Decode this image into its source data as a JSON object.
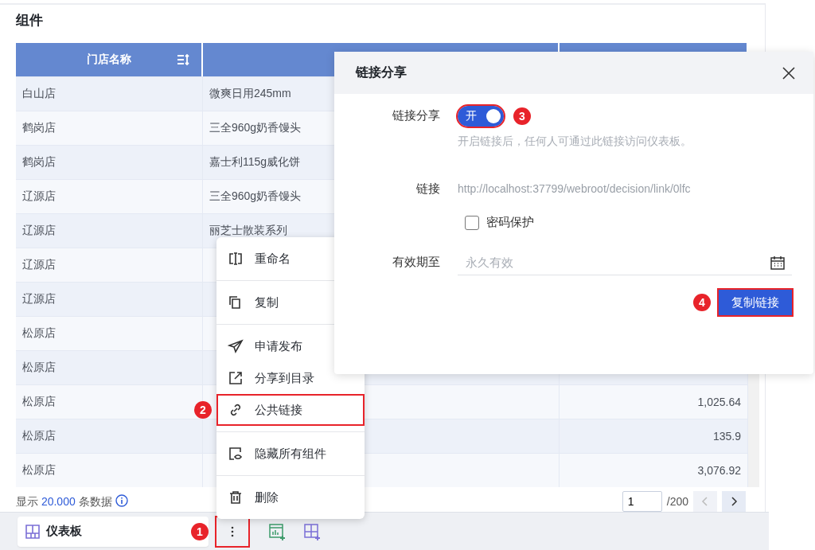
{
  "panel": {
    "title": "组件"
  },
  "table": {
    "header": {
      "column_1": "门店名称"
    },
    "rows": [
      {
        "store": "白山店",
        "product": "微爽日用245mm"
      },
      {
        "store": "鹤岗店",
        "product": "三全960g奶香馒头"
      },
      {
        "store": "鹤岗店",
        "product": "嘉士利115g威化饼"
      },
      {
        "store": "辽源店",
        "product": "三全960g奶香馒头"
      },
      {
        "store": "辽源店",
        "product": "丽芝士散装系列"
      },
      {
        "store": "辽源店"
      },
      {
        "store": "辽源店"
      },
      {
        "store": "松原店"
      },
      {
        "store": "松原店"
      },
      {
        "store": "松原店",
        "value": "1,025.64"
      },
      {
        "store": "松原店",
        "value": "135.9"
      },
      {
        "store": "松原店",
        "value": "3,076.92"
      }
    ]
  },
  "footer": {
    "prefix": "显示",
    "count": "20.000",
    "suffix": "条数据"
  },
  "pagination": {
    "page": "1",
    "total": "/200"
  },
  "bottom_bar": {
    "tab": "仪表板",
    "more_highlighted": true,
    "badge": "1"
  },
  "menu": {
    "groups": [
      [
        {
          "label": "重命名",
          "highlighted": false
        }
      ],
      [
        {
          "label": "复制",
          "highlighted": false
        }
      ],
      [
        {
          "label": "申请发布",
          "highlighted": false
        },
        {
          "label": "分享到目录",
          "highlighted": false
        },
        {
          "label": "公共链接",
          "highlighted": true,
          "badge": "2"
        }
      ],
      [
        {
          "label": "隐藏所有组件",
          "highlighted": false
        }
      ],
      [
        {
          "label": "删除",
          "highlighted": false
        }
      ]
    ]
  },
  "dialog": {
    "title": "链接分享",
    "fields": [
      {
        "kind": "switch",
        "label": "链接分享",
        "on": true,
        "text": "开",
        "highlighted": true,
        "badge": "3",
        "help": "开启链接后，任何人可通过此链接访问仪表板。"
      },
      {
        "kind": "link",
        "label": "链接",
        "value": "http://localhost:37799/webroot/decision/link/0lfc"
      },
      {
        "kind": "checkbox",
        "label": "密码保护",
        "checked": false
      },
      {
        "kind": "date",
        "label": "有效期至",
        "placeholder": "永久有效"
      }
    ],
    "button": {
      "label": "复制链接",
      "highlighted": true,
      "badge": "4"
    }
  }
}
